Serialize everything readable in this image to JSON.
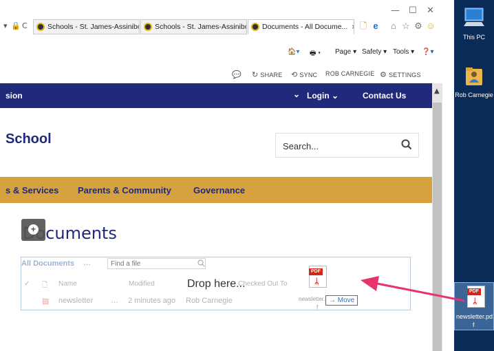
{
  "window": {
    "controls": {
      "minimize": "—",
      "maximize": "☐",
      "close": "✕"
    }
  },
  "tabs": [
    {
      "label": "Schools - St. James-Assiniboi...",
      "active": false
    },
    {
      "label": "Schools - St. James-Assiniboi...",
      "active": false
    },
    {
      "label": "Documents - All Docume...",
      "active": true,
      "close": "×"
    }
  ],
  "command_bar": {
    "page": "Page ▾",
    "safety": "Safety ▾",
    "tools": "Tools ▾"
  },
  "sp_topbar": {
    "share": "SHARE",
    "sync": "SYNC",
    "user": "ROB CARNEGIE",
    "settings": "SETTINGS"
  },
  "nav": {
    "left": "sion",
    "chevron": "⌄",
    "login": "Login",
    "contact": "Contact Us"
  },
  "header": {
    "school": "School",
    "search_placeholder": "Search..."
  },
  "menu": {
    "services": "s & Services",
    "parents": "Parents & Community",
    "governance": "Governance"
  },
  "documents": {
    "title": "Documents",
    "all_docs": "All Documents",
    "more": "…",
    "find_placeholder": "Find a file",
    "col_name": "Name",
    "col_modified": "Modified",
    "col_checked": "Checked Out To",
    "row_name": "newsletter",
    "row_more": "…",
    "row_modified": "2 minutes ago",
    "row_modified_by": "Rob Carnegie",
    "drop_here": "Drop here..."
  },
  "drag": {
    "file_line1": "newsletter.pd",
    "file_line2": "f",
    "move_label": "→ Move",
    "pdf_badge": "PDF"
  },
  "desktop": {
    "this_pc": "This PC",
    "rob": "Rob Carnegie",
    "pdf_line1": "newsletter.pd",
    "pdf_line2": "f"
  },
  "colors": {
    "nav_band": "#20297a",
    "menu_band": "#d5a23e",
    "desktop_bg": "#0a2a57",
    "arrow": "#e8336c",
    "pdf_red": "#d0271d"
  }
}
